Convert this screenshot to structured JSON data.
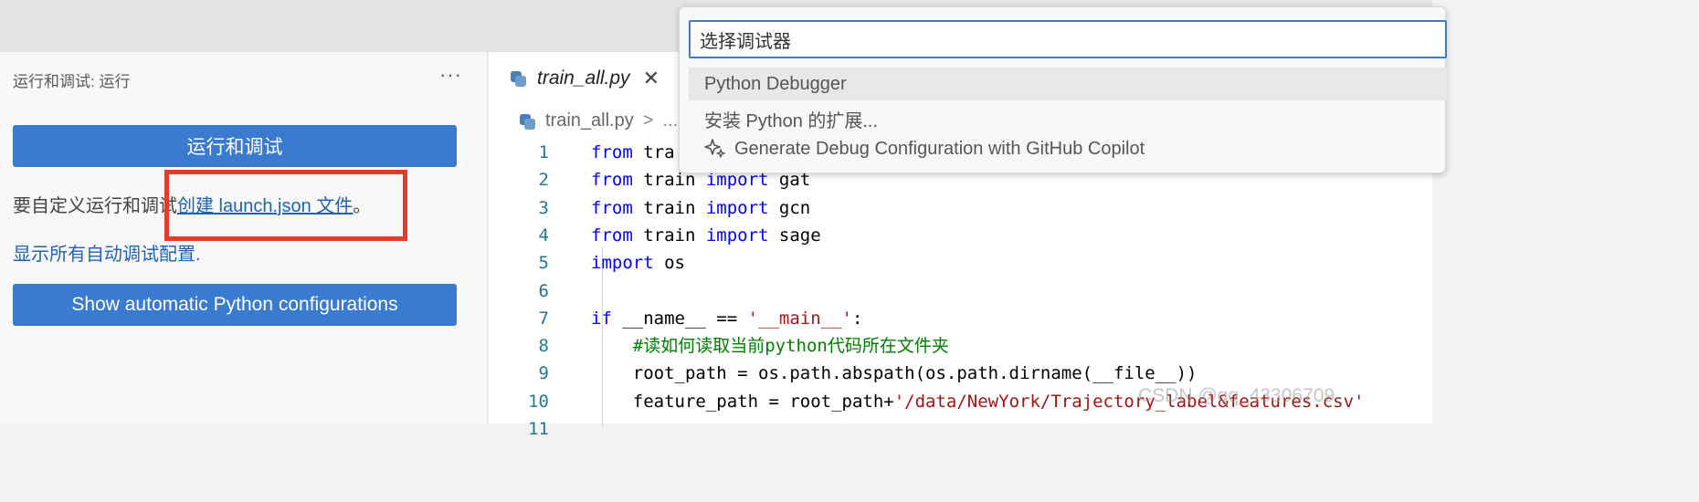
{
  "sidebar": {
    "title": "运行和调试: 运行",
    "more_label": "···",
    "run_button": "运行和调试",
    "hint_prefix": "要自定义运行和调试",
    "hint_link": "创建 launch.json 文件",
    "hint_suffix": "。",
    "show_all_link": "显示所有自动调试配置.",
    "python_button": "Show automatic Python configurations"
  },
  "editor": {
    "tab": {
      "label": "train_all.py",
      "close": "✕",
      "icon": "python-file-icon"
    },
    "breadcrumb": {
      "label": "train_all.py",
      "separator": ">",
      "trailing": "..."
    },
    "lines": [
      {
        "n": "1",
        "parts": [
          [
            "kw",
            "from"
          ],
          [
            "t",
            " tra"
          ]
        ]
      },
      {
        "n": "2",
        "parts": [
          [
            "kw",
            "from"
          ],
          [
            "t",
            " train "
          ],
          [
            "kw",
            "import"
          ],
          [
            "t",
            " gat"
          ]
        ]
      },
      {
        "n": "3",
        "parts": [
          [
            "kw",
            "from"
          ],
          [
            "t",
            " train "
          ],
          [
            "kw",
            "import"
          ],
          [
            "t",
            " gcn"
          ]
        ]
      },
      {
        "n": "4",
        "parts": [
          [
            "kw",
            "from"
          ],
          [
            "t",
            " train "
          ],
          [
            "kw",
            "import"
          ],
          [
            "t",
            " sage"
          ]
        ]
      },
      {
        "n": "5",
        "parts": [
          [
            "kw",
            "import"
          ],
          [
            "t",
            " os"
          ]
        ]
      },
      {
        "n": "6",
        "parts": []
      },
      {
        "n": "7",
        "parts": [
          [
            "kw",
            "if"
          ],
          [
            "t",
            " __name__ == "
          ],
          [
            "str",
            "'__main__'"
          ],
          [
            "t",
            ":"
          ]
        ]
      },
      {
        "n": "8",
        "parts": [
          [
            "t",
            "    "
          ],
          [
            "cm",
            "#读如何读取当前python代码所在文件夹"
          ]
        ]
      },
      {
        "n": "9",
        "parts": [
          [
            "t",
            "    root_path = os.path.abspath(os.path.dirname(__file__))"
          ]
        ]
      },
      {
        "n": "10",
        "parts": [
          [
            "t",
            "    feature_path = root_path+"
          ],
          [
            "str",
            "'/data/NewYork/Trajectory_label&features.csv'"
          ]
        ]
      },
      {
        "n": "11",
        "parts": []
      }
    ]
  },
  "quick_pick": {
    "placeholder": "选择调试器",
    "items": [
      {
        "label": "Python Debugger"
      },
      {
        "label": "安装 Python 的扩展..."
      },
      {
        "label": "Generate Debug Configuration with GitHub Copilot",
        "icon": "sparkle-icon"
      }
    ]
  },
  "watermark": "CSDN @qq_43306709"
}
